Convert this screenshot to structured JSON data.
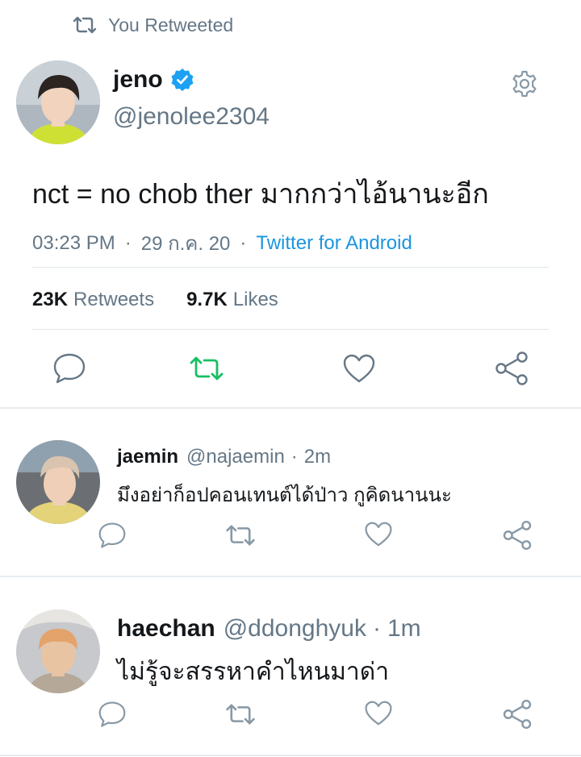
{
  "retweet_banner": {
    "text": "You Retweeted"
  },
  "tweet": {
    "display_name": "jeno",
    "handle": "@jenolee2304",
    "text": "nct = no chob ther มากกว่าไอ้นานะอีก",
    "time": "03:23 PM",
    "date": "29 ก.ค. 20",
    "separator": "·",
    "source": "Twitter for Android",
    "retweets_count": "23K",
    "retweets_label": "Retweets",
    "likes_count": "9.7K",
    "likes_label": "Likes"
  },
  "replies": [
    {
      "name": "jaemin",
      "handle": "@najaemin",
      "separator": "·",
      "time": "2m",
      "text": "มึงอย่าก็อปคอนเทนต์ได้ป่าว กูคิดนานนะ"
    },
    {
      "name": "haechan",
      "handle": "@ddonghyuk",
      "separator": "·",
      "time": "1m",
      "text": "ไม่รู้จะสรรหาคำไหนมาด่า"
    }
  ],
  "icons": {
    "retweet_banner": "retweet-icon",
    "verified": "verified-badge-icon",
    "settings": "gear-icon",
    "reply": "reply-icon",
    "retweet": "retweet-icon",
    "like": "heart-icon",
    "share": "share-icon"
  },
  "colors": {
    "link": "#1b95e0",
    "muted": "#657786",
    "retweeted": "#17bf63",
    "verified": "#1da1f2",
    "text": "#14171a",
    "divider": "#e1e8ed"
  }
}
